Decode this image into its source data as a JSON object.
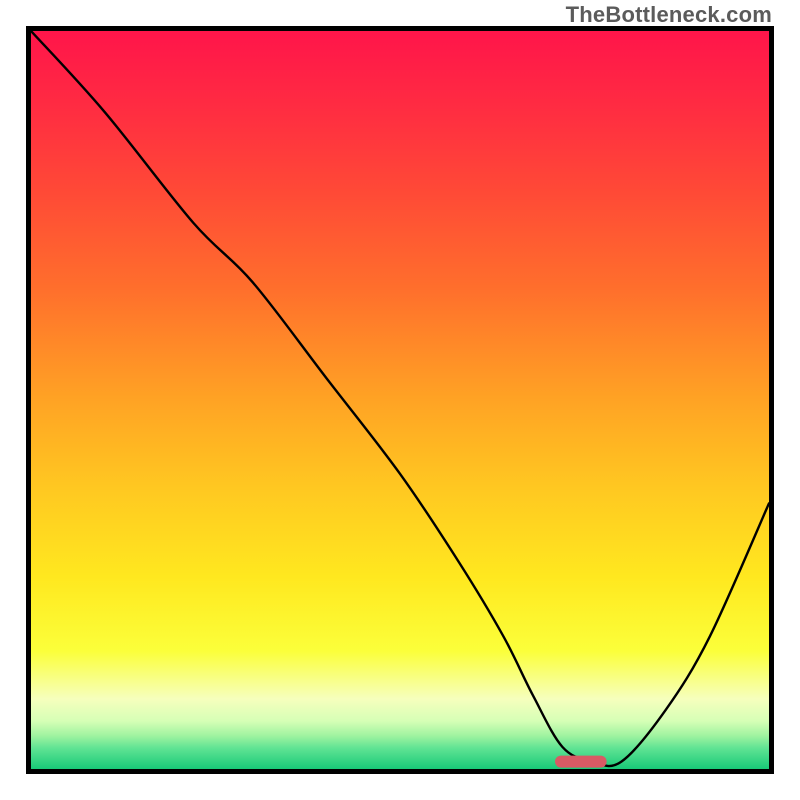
{
  "watermark": "TheBottleneck.com",
  "colors": {
    "gradient_stops": [
      {
        "offset": 0.0,
        "color": "#ff154a"
      },
      {
        "offset": 0.1,
        "color": "#ff2b42"
      },
      {
        "offset": 0.22,
        "color": "#ff4a36"
      },
      {
        "offset": 0.35,
        "color": "#ff6f2c"
      },
      {
        "offset": 0.5,
        "color": "#ffa324"
      },
      {
        "offset": 0.62,
        "color": "#ffc821"
      },
      {
        "offset": 0.74,
        "color": "#ffe81f"
      },
      {
        "offset": 0.84,
        "color": "#fbff3a"
      },
      {
        "offset": 0.905,
        "color": "#f6ffbd"
      },
      {
        "offset": 0.935,
        "color": "#d6ffb6"
      },
      {
        "offset": 0.955,
        "color": "#9ff3a0"
      },
      {
        "offset": 0.972,
        "color": "#5fe393"
      },
      {
        "offset": 1.0,
        "color": "#18c978"
      }
    ],
    "frame": "#000000",
    "marker": "#d85a64"
  },
  "chart_data": {
    "type": "line",
    "title": "",
    "xlabel": "",
    "ylabel": "",
    "xlim": [
      0,
      100
    ],
    "ylim": [
      0,
      100
    ],
    "grid": false,
    "legend": false,
    "annotations": [
      "TheBottleneck.com"
    ],
    "series": [
      {
        "name": "bottleneck-curve",
        "x": [
          0,
          10,
          22,
          30,
          40,
          50,
          58,
          64,
          68,
          72,
          76,
          80,
          86,
          92,
          100
        ],
        "y": [
          100,
          89,
          74,
          66,
          53,
          40,
          28,
          18,
          10,
          3,
          1,
          1,
          8,
          18,
          36
        ]
      }
    ],
    "marker": {
      "x_start": 71,
      "x_end": 78,
      "y": 1
    }
  }
}
